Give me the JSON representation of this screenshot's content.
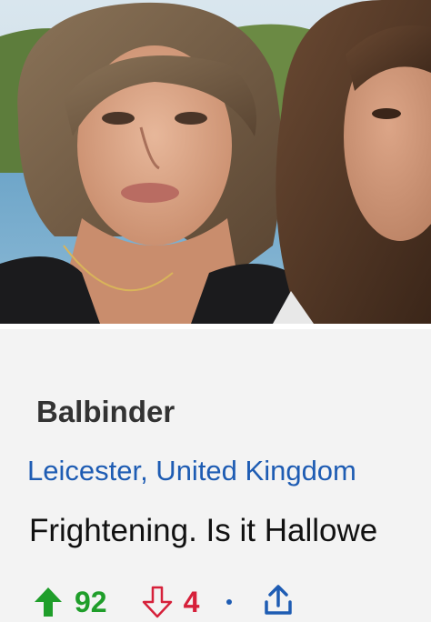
{
  "comment": {
    "author": "Balbinder",
    "location": "Leicester, United Kingdom",
    "text": "Frightening. Is it Hallowe",
    "upvotes": "92",
    "downvotes": "4"
  },
  "icons": {
    "upvote": "arrow-up-icon",
    "downvote": "arrow-down-icon",
    "share": "share-icon"
  },
  "colors": {
    "upvote": "#1f9e2a",
    "downvote": "#d6203a",
    "link": "#1e5cb3",
    "background": "#f3f3f3"
  }
}
